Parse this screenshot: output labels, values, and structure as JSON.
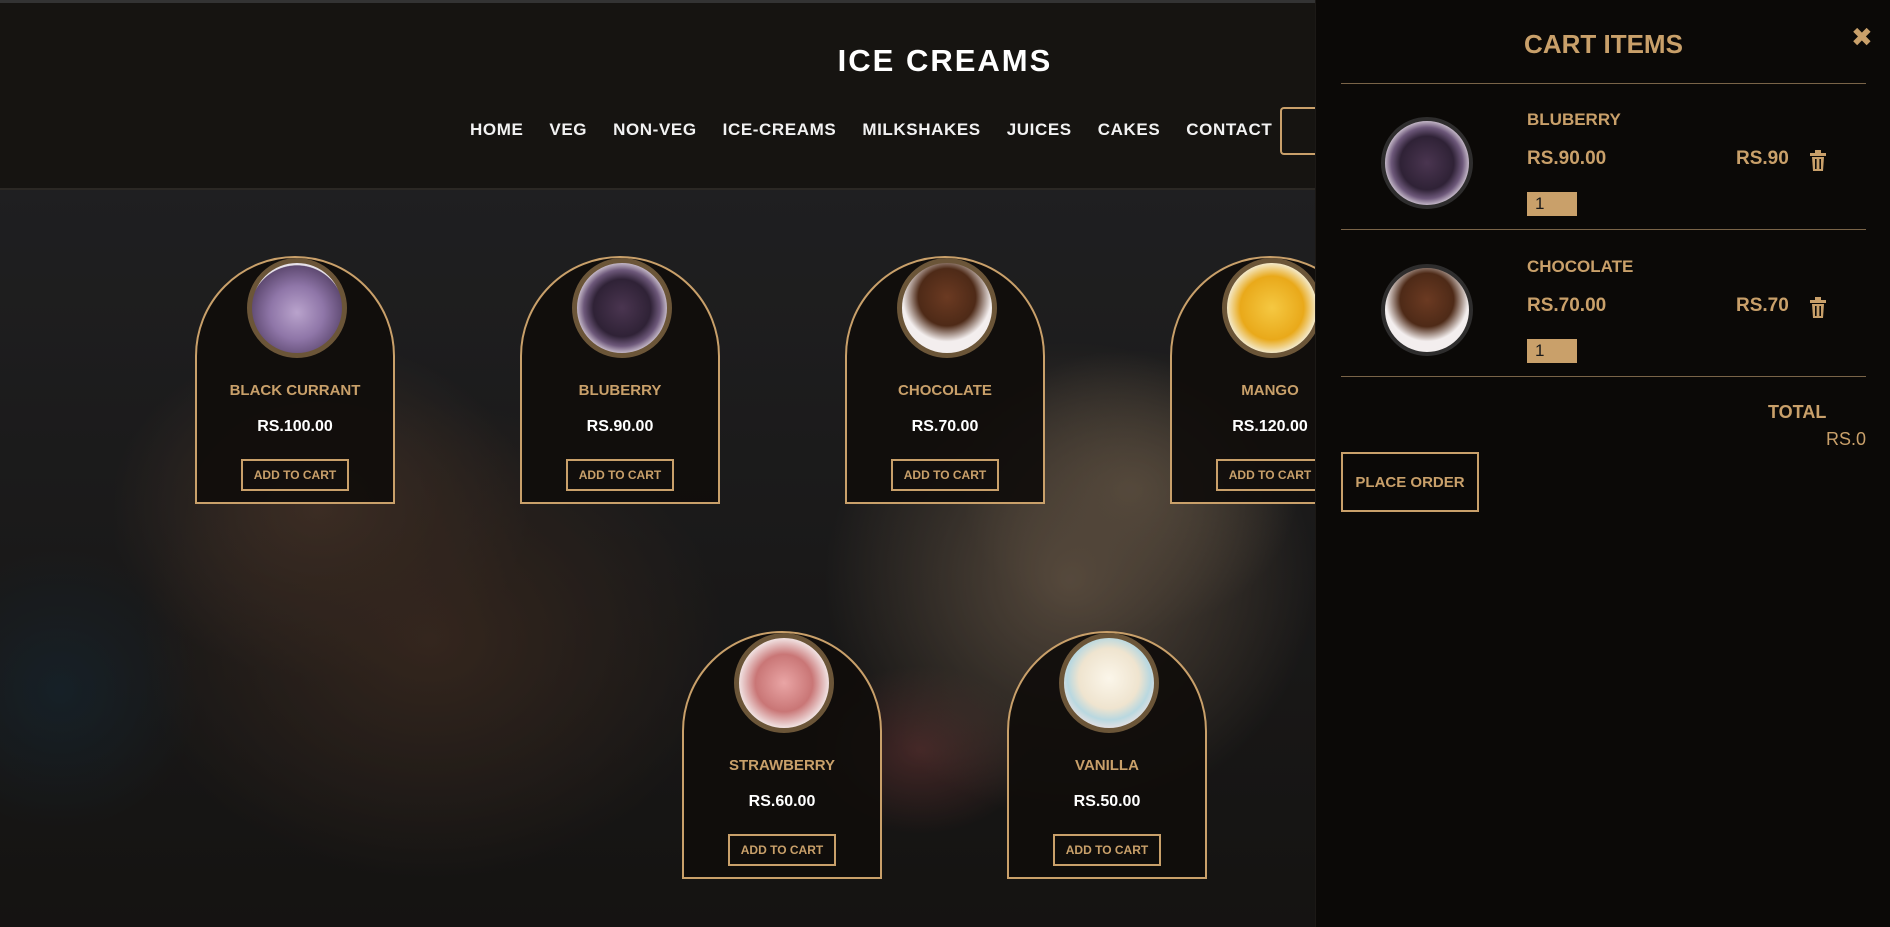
{
  "header": {
    "title": "ICE CREAMS",
    "nav": [
      "HOME",
      "VEG",
      "NON-VEG",
      "ICE-CREAMS",
      "MILKSHAKES",
      "JUICES",
      "CAKES",
      "CONTACT"
    ]
  },
  "products": [
    {
      "name": "BLACK CURRANT",
      "price": "RS.100.00",
      "button": "ADD TO CART",
      "image": "black-currant-ice-cream"
    },
    {
      "name": "BLUBERRY",
      "price": "RS.90.00",
      "button": "ADD TO CART",
      "image": "blueberry-ice-cream"
    },
    {
      "name": "CHOCOLATE",
      "price": "RS.70.00",
      "button": "ADD TO CART",
      "image": "chocolate-ice-cream"
    },
    {
      "name": "MANGO",
      "price": "RS.120.00",
      "button": "ADD TO CART",
      "image": "mango-ice-cream"
    },
    {
      "name": "STRAWBERRY",
      "price": "RS.60.00",
      "button": "ADD TO CART",
      "image": "strawberry-ice-cream"
    },
    {
      "name": "VANILLA",
      "price": "RS.50.00",
      "button": "ADD TO CART",
      "image": "vanilla-ice-cream"
    }
  ],
  "cart": {
    "title": "CART ITEMS",
    "close_icon": "close-icon",
    "items": [
      {
        "name": "BLUBERRY",
        "price": "RS.90.00",
        "total": "RS.90",
        "qty": "1",
        "image": "blueberry-ice-cream"
      },
      {
        "name": "CHOCOLATE",
        "price": "RS.70.00",
        "total": "RS.70",
        "qty": "1",
        "image": "chocolate-ice-cream"
      }
    ],
    "total_label": "TOTAL",
    "total_value": "RS.0",
    "place_order": "PLACE ORDER"
  },
  "colors": {
    "accent": "#c9a06a",
    "background": "#0b0907",
    "header": "#161411"
  }
}
